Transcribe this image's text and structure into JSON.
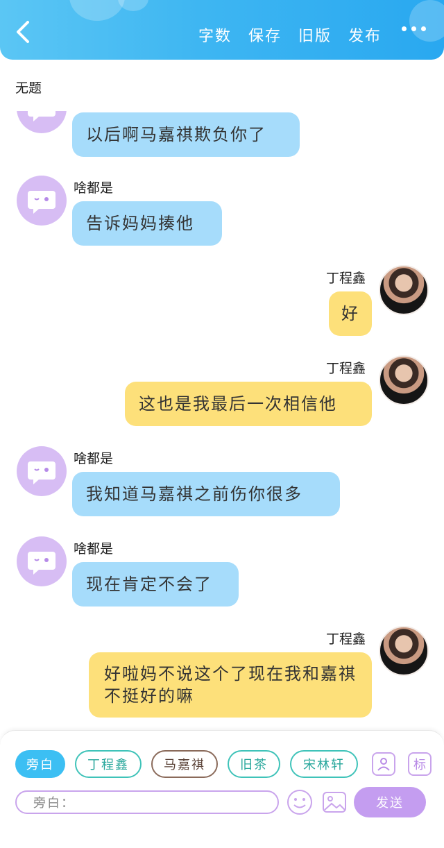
{
  "header": {
    "actions": [
      "字数",
      "保存",
      "旧版",
      "发布"
    ]
  },
  "title": "无题",
  "messages": [
    {
      "side": "left",
      "name": "",
      "text": "以后啊马嘉祺欺负你了",
      "color": "blue"
    },
    {
      "side": "left",
      "name": "啥都是",
      "text": "告诉妈妈揍他",
      "color": "blue"
    },
    {
      "side": "right",
      "name": "丁程鑫",
      "text": "好",
      "color": "yellow"
    },
    {
      "side": "right",
      "name": "丁程鑫",
      "text": "这也是我最后一次相信他",
      "color": "yellow"
    },
    {
      "side": "left",
      "name": "啥都是",
      "text": "我知道马嘉祺之前伤你很多",
      "color": "blue"
    },
    {
      "side": "left",
      "name": "啥都是",
      "text": "现在肯定不会了",
      "color": "blue"
    },
    {
      "side": "right",
      "name": "丁程鑫",
      "text": "好啦妈不说这个了现在我和嘉祺不挺好的嘛",
      "color": "yellow"
    }
  ],
  "bottom": {
    "chips": [
      "旁白",
      "丁程鑫",
      "马嘉祺",
      "旧茶",
      "宋林轩"
    ],
    "selected_chip": "旁白",
    "mark_label": "标",
    "input_value": "旁白：",
    "send_label": "发送"
  },
  "colors": {
    "header": "#3eb6f2",
    "bubble_left": "#a6dcfb",
    "bubble_right": "#fde07a",
    "bot_avatar": "#d7bdf4",
    "accent_purple": "#c49df0"
  }
}
